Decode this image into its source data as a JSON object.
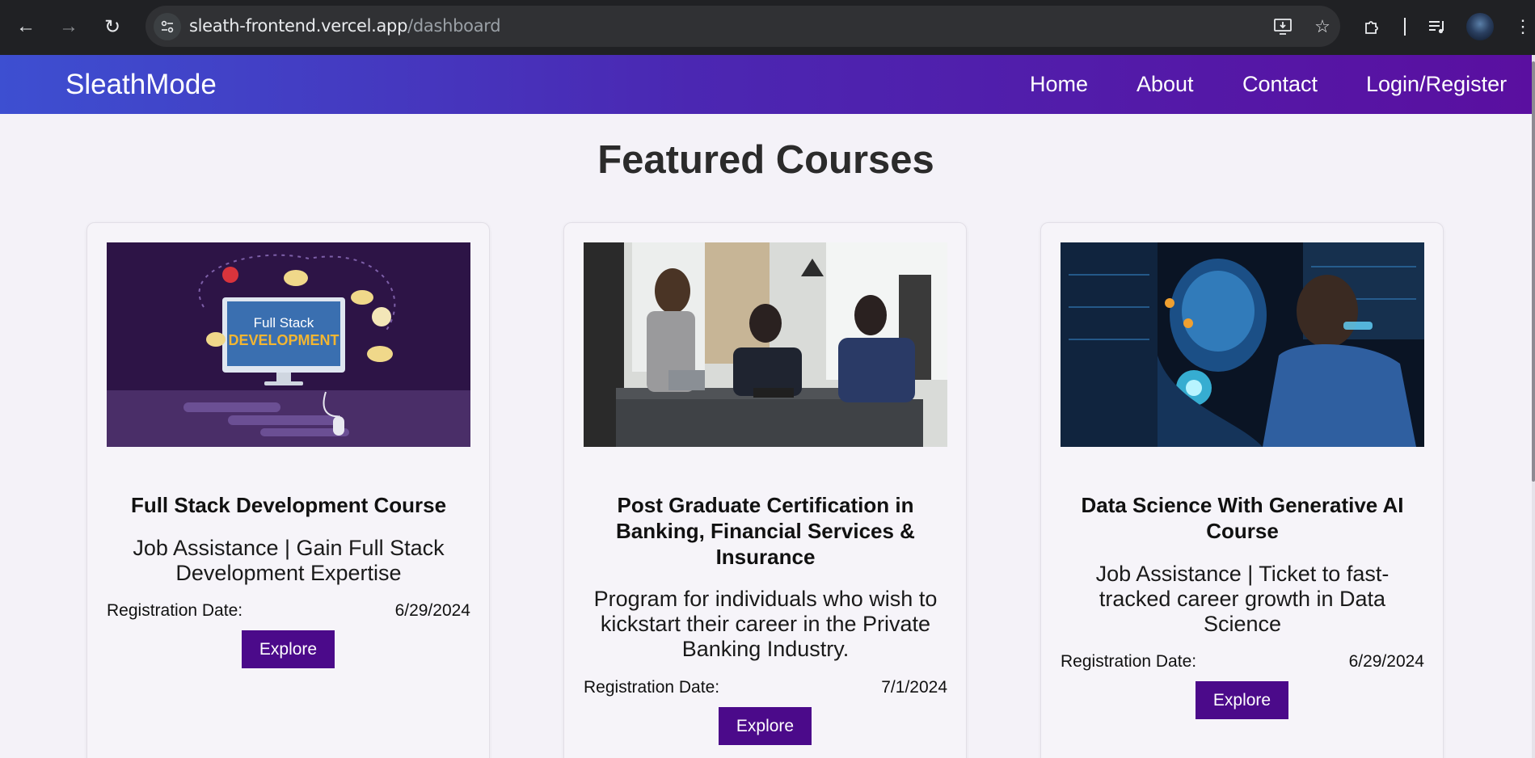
{
  "browser": {
    "url_host": "sleath-frontend.vercel.app",
    "url_path": "/dashboard"
  },
  "site": {
    "brand": "SleathMode",
    "nav": [
      "Home",
      "About",
      "Contact",
      "Login/Register"
    ],
    "accent": "#4b0a8a"
  },
  "main": {
    "title": "Featured Courses",
    "registration_label": "Registration Date:",
    "explore_label": "Explore",
    "courses": [
      {
        "title": "Full Stack Development Course",
        "description": "Job Assistance | Gain Full Stack Development Expertise",
        "date": "6/29/2024",
        "image_text_1": "Full Stack",
        "image_text_2": "DEVELOPMENT"
      },
      {
        "title": "Post Graduate Certification in Banking, Financial Services & Insurance",
        "description": "Program for individuals who wish to kickstart their career in the Private Banking Industry.",
        "date": "7/1/2024"
      },
      {
        "title": "Data Science With Generative AI Course",
        "description": "Job Assistance | Ticket to fast-tracked career growth in Data Science",
        "date": "6/29/2024"
      }
    ]
  }
}
